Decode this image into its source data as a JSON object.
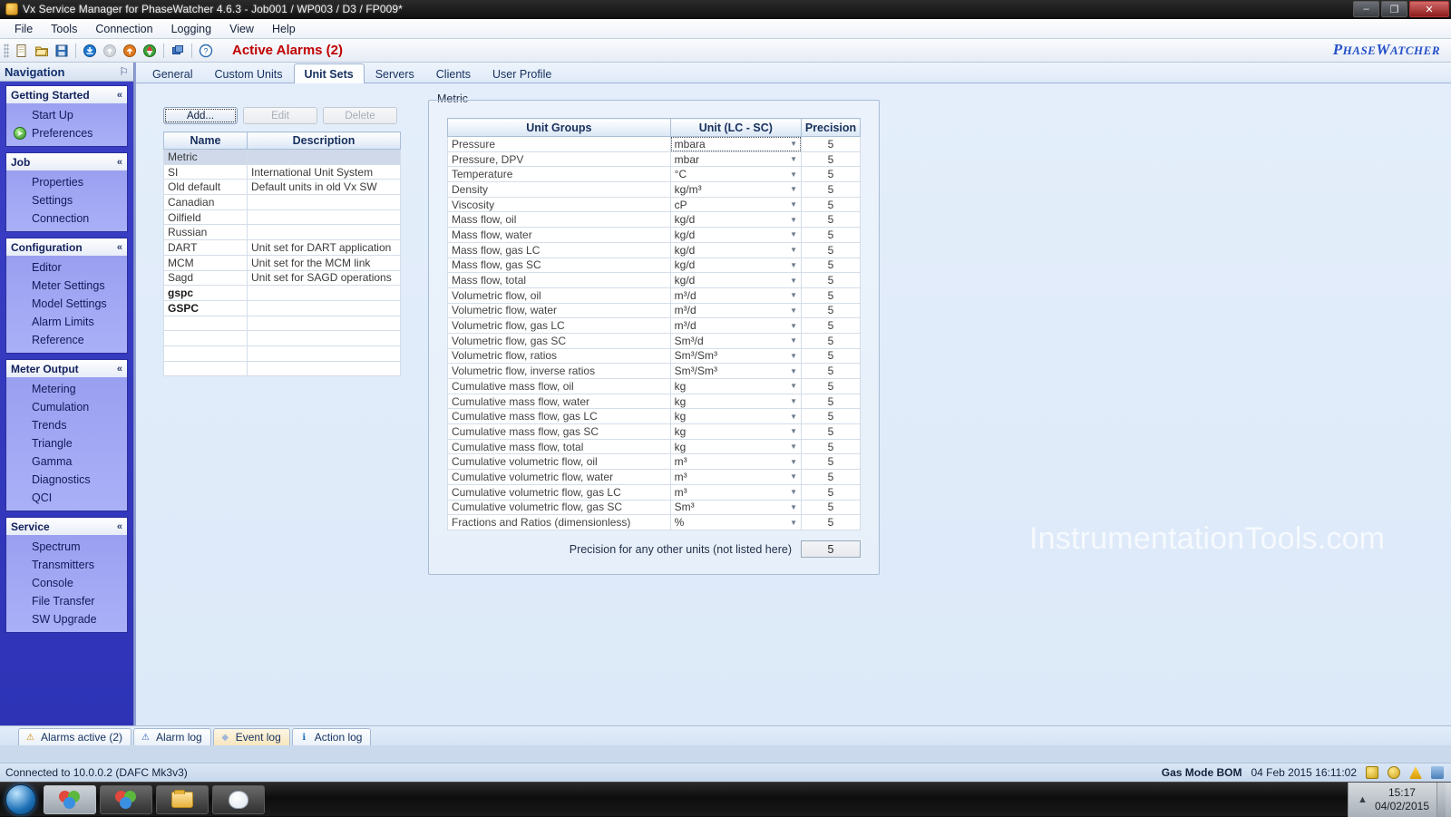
{
  "window": {
    "title": "Vx Service Manager for PhaseWatcher 4.6.3 - Job001 / WP003 / D3 / FP009*",
    "minimize": "–",
    "maximize": "❐",
    "close": "✕",
    "icon": "app-icon"
  },
  "menubar": {
    "items": [
      "File",
      "Tools",
      "Connection",
      "Logging",
      "View",
      "Help"
    ]
  },
  "toolbar": {
    "buttons": [
      {
        "name": "new-document-icon",
        "glyph": "▤"
      },
      {
        "name": "open-folder-icon",
        "glyph": "▣"
      },
      {
        "name": "save-icon",
        "glyph": "■"
      },
      {
        "name": "download-icon",
        "glyph": "⬇"
      },
      {
        "name": "upload-disabled-icon",
        "glyph": "⬆"
      },
      {
        "name": "upload-icon",
        "glyph": "⬆"
      },
      {
        "name": "refresh-icon",
        "glyph": "⟳"
      },
      {
        "name": "window-icon",
        "glyph": "❐"
      },
      {
        "name": "help-icon",
        "glyph": "?"
      }
    ],
    "active_alarms": "Active Alarms (2)",
    "brand": "PhaseWatcher",
    "brand_p": "P",
    "brand_hase": "HASE",
    "brand_w": "W",
    "brand_atcher": "ATCHER"
  },
  "navigation": {
    "header": "Navigation",
    "pin": "⚐",
    "groups": [
      {
        "title": "Getting Started",
        "chevron": "«",
        "items": [
          {
            "label": "Start Up",
            "icon": null
          },
          {
            "label": "Preferences",
            "icon": "green-arrow-icon"
          }
        ]
      },
      {
        "title": "Job",
        "chevron": "«",
        "items": [
          {
            "label": "Properties",
            "icon": null
          },
          {
            "label": "Settings",
            "icon": null
          },
          {
            "label": "Connection",
            "icon": null
          }
        ]
      },
      {
        "title": "Configuration",
        "chevron": "«",
        "items": [
          {
            "label": "Editor",
            "icon": null
          },
          {
            "label": "Meter Settings",
            "icon": null
          },
          {
            "label": "Model Settings",
            "icon": null
          },
          {
            "label": "Alarm Limits",
            "icon": null
          },
          {
            "label": "Reference",
            "icon": null
          }
        ]
      },
      {
        "title": "Meter Output",
        "chevron": "«",
        "items": [
          {
            "label": "Metering",
            "icon": null
          },
          {
            "label": "Cumulation",
            "icon": null
          },
          {
            "label": "Trends",
            "icon": null
          },
          {
            "label": "Triangle",
            "icon": null
          },
          {
            "label": "Gamma",
            "icon": null
          },
          {
            "label": "Diagnostics",
            "icon": null
          },
          {
            "label": "QCI",
            "icon": null
          }
        ]
      },
      {
        "title": "Service",
        "chevron": "«",
        "items": [
          {
            "label": "Spectrum",
            "icon": null
          },
          {
            "label": "Transmitters",
            "icon": null
          },
          {
            "label": "Console",
            "icon": null
          },
          {
            "label": "File Transfer",
            "icon": null
          },
          {
            "label": "SW Upgrade",
            "icon": null
          }
        ]
      }
    ]
  },
  "tabs": [
    {
      "label": "General",
      "active": false
    },
    {
      "label": "Custom Units",
      "active": false
    },
    {
      "label": "Unit Sets",
      "active": true
    },
    {
      "label": "Servers",
      "active": false
    },
    {
      "label": "Clients",
      "active": false
    },
    {
      "label": "User Profile",
      "active": false
    }
  ],
  "unit_sets": {
    "buttons": {
      "add": "Add...",
      "edit": "Edit",
      "delete": "Delete"
    },
    "columns": [
      "Name",
      "Description"
    ],
    "rows": [
      {
        "name": "Metric",
        "description": "",
        "selected": true,
        "bold": false
      },
      {
        "name": "SI",
        "description": "International Unit System",
        "selected": false,
        "bold": false
      },
      {
        "name": "Old default",
        "description": "Default units in old Vx SW",
        "selected": false,
        "bold": false
      },
      {
        "name": "Canadian",
        "description": "",
        "selected": false,
        "bold": false
      },
      {
        "name": "Oilfield",
        "description": "",
        "selected": false,
        "bold": false
      },
      {
        "name": "Russian",
        "description": "",
        "selected": false,
        "bold": false
      },
      {
        "name": "DART",
        "description": "Unit set for DART application",
        "selected": false,
        "bold": false
      },
      {
        "name": "MCM",
        "description": "Unit set for the MCM link",
        "selected": false,
        "bold": false
      },
      {
        "name": "Sagd",
        "description": "Unit set for SAGD operations",
        "selected": false,
        "bold": false
      },
      {
        "name": "gspc",
        "description": "",
        "selected": false,
        "bold": true
      },
      {
        "name": "GSPC",
        "description": "",
        "selected": false,
        "bold": true
      },
      {
        "name": "",
        "description": "",
        "selected": false,
        "bold": false
      },
      {
        "name": "",
        "description": "",
        "selected": false,
        "bold": false
      },
      {
        "name": "",
        "description": "",
        "selected": false,
        "bold": false
      },
      {
        "name": "",
        "description": "",
        "selected": false,
        "bold": false
      }
    ]
  },
  "metric_panel": {
    "legend": "Metric",
    "columns": [
      "Unit Groups",
      "Unit (LC - SC)",
      "Precision"
    ],
    "dropdown_arrow": "▼",
    "rows": [
      {
        "group": "Pressure",
        "unit": "mbara",
        "precision": "5",
        "focused": true
      },
      {
        "group": "Pressure, DPV",
        "unit": "mbar",
        "precision": "5",
        "focused": false
      },
      {
        "group": "Temperature",
        "unit": "°C",
        "precision": "5",
        "focused": false
      },
      {
        "group": "Density",
        "unit": "kg/m³",
        "precision": "5",
        "focused": false
      },
      {
        "group": "Viscosity",
        "unit": "cP",
        "precision": "5",
        "focused": false
      },
      {
        "group": "Mass flow, oil",
        "unit": "kg/d",
        "precision": "5",
        "focused": false
      },
      {
        "group": "Mass flow, water",
        "unit": "kg/d",
        "precision": "5",
        "focused": false
      },
      {
        "group": "Mass flow, gas LC",
        "unit": "kg/d",
        "precision": "5",
        "focused": false
      },
      {
        "group": "Mass flow, gas SC",
        "unit": "kg/d",
        "precision": "5",
        "focused": false
      },
      {
        "group": "Mass flow, total",
        "unit": "kg/d",
        "precision": "5",
        "focused": false
      },
      {
        "group": "Volumetric flow, oil",
        "unit": "m³/d",
        "precision": "5",
        "focused": false
      },
      {
        "group": "Volumetric flow, water",
        "unit": "m³/d",
        "precision": "5",
        "focused": false
      },
      {
        "group": "Volumetric flow, gas LC",
        "unit": "m³/d",
        "precision": "5",
        "focused": false
      },
      {
        "group": "Volumetric flow, gas SC",
        "unit": "Sm³/d",
        "precision": "5",
        "focused": false
      },
      {
        "group": "Volumetric flow, ratios",
        "unit": "Sm³/Sm³",
        "precision": "5",
        "focused": false
      },
      {
        "group": "Volumetric flow, inverse ratios",
        "unit": "Sm³/Sm³",
        "precision": "5",
        "focused": false
      },
      {
        "group": "Cumulative mass flow, oil",
        "unit": "kg",
        "precision": "5",
        "focused": false
      },
      {
        "group": "Cumulative mass flow, water",
        "unit": "kg",
        "precision": "5",
        "focused": false
      },
      {
        "group": "Cumulative mass flow, gas LC",
        "unit": "kg",
        "precision": "5",
        "focused": false
      },
      {
        "group": "Cumulative mass flow, gas SC",
        "unit": "kg",
        "precision": "5",
        "focused": false
      },
      {
        "group": "Cumulative mass flow, total",
        "unit": "kg",
        "precision": "5",
        "focused": false
      },
      {
        "group": "Cumulative volumetric flow, oil",
        "unit": "m³",
        "precision": "5",
        "focused": false
      },
      {
        "group": "Cumulative volumetric flow, water",
        "unit": "m³",
        "precision": "5",
        "focused": false
      },
      {
        "group": "Cumulative volumetric flow, gas LC",
        "unit": "m³",
        "precision": "5",
        "focused": false
      },
      {
        "group": "Cumulative volumetric flow, gas SC",
        "unit": "Sm³",
        "precision": "5",
        "focused": false
      },
      {
        "group": "Fractions and Ratios (dimensionless)",
        "unit": "%",
        "precision": "5",
        "focused": false
      }
    ],
    "precision_other_label": "Precision for any other units (not listed here)",
    "precision_other_value": "5"
  },
  "watermark": "InstrumentationTools.com",
  "bottom_tabs": [
    {
      "label": "Alarms active  (2)",
      "icon": "warning-icon",
      "glyph": "⚠",
      "kind": "warn"
    },
    {
      "label": "Alarm log",
      "icon": "alarm-icon",
      "glyph": "⚠",
      "kind": "alarm"
    },
    {
      "label": "Event log",
      "icon": "event-icon",
      "glyph": "◆",
      "kind": "event"
    },
    {
      "label": "Action log",
      "icon": "info-icon",
      "glyph": "ℹ",
      "kind": "action"
    }
  ],
  "statusbar": {
    "connection": "Connected to 10.0.0.2 (DAFC Mk3v3)",
    "gas_mode": "Gas Mode  BOM",
    "datetime": "04 Feb 2015 16:11:02",
    "tray_icons": [
      "net-icon-1",
      "net-icon-2",
      "warning-icon",
      "device-icon"
    ]
  },
  "taskbar": {
    "start": "start-orb-icon",
    "buttons": [
      {
        "name": "taskbar-app-vx-1",
        "icon": "colors-icon"
      },
      {
        "name": "taskbar-app-vx-2",
        "icon": "colors-icon"
      },
      {
        "name": "taskbar-explorer",
        "icon": "folder-icon"
      },
      {
        "name": "taskbar-paint",
        "icon": "paint-icon"
      }
    ],
    "tray_chevron": "▲",
    "clock_time": "15:17",
    "clock_date": "04/02/2015"
  },
  "colors": {
    "alarm_red": "#c00000",
    "brand_blue": "#2450c8",
    "nav_blue": "#2e33b6",
    "selection": "#cfd9ea"
  }
}
